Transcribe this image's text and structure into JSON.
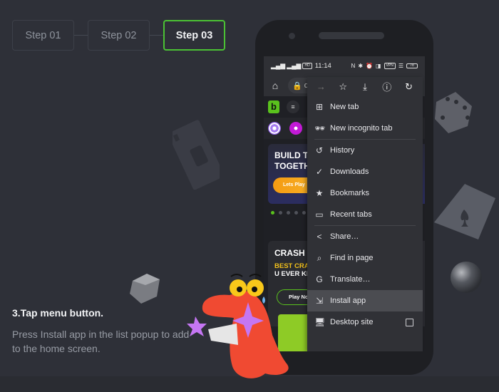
{
  "steps": [
    {
      "label": "Step 01",
      "active": false
    },
    {
      "label": "Step 02",
      "active": false
    },
    {
      "label": "Step 03",
      "active": true
    }
  ],
  "instruction": {
    "title": "3.Tap menu button.",
    "description": "Press Install app in the list popup to add to the home screen."
  },
  "phone": {
    "status_bar": {
      "left_icons": [
        "signal-icon",
        "signal-icon",
        "hd-icon"
      ],
      "time": "11:14",
      "right_icons": [
        "nfc-icon",
        "bluetooth-icon",
        "alarm-icon",
        "vibrate-icon",
        "vpn-icon",
        "wifi-icon",
        "battery-icon"
      ],
      "vpn_label": "VPN",
      "battery_label": "78"
    },
    "url_bar": {
      "home_icon": "home-icon",
      "lock_icon": "lock-icon",
      "url_text": "d"
    },
    "site": {
      "logo_text": "b",
      "banner1": {
        "title_line1": "BUILD T",
        "title_line2": "TOGETH",
        "button": "Lets Play"
      },
      "banner2": {
        "title": "CRASH",
        "sub_line1": "BEST CRAS",
        "sub_line2": "U EVER KN",
        "button": "Play Now"
      }
    },
    "menu": {
      "toolbar": [
        {
          "icon": "forward-icon",
          "glyph": "→",
          "enabled": false
        },
        {
          "icon": "star-icon",
          "glyph": "☆",
          "enabled": true
        },
        {
          "icon": "download-icon",
          "glyph": "⤓",
          "enabled": true
        },
        {
          "icon": "info-icon",
          "glyph": "ⓘ",
          "enabled": true
        },
        {
          "icon": "refresh-icon",
          "glyph": "↻",
          "enabled": true
        }
      ],
      "groups": [
        [
          {
            "label": "New tab",
            "icon": "new-tab-icon",
            "glyph": "⊞"
          },
          {
            "label": "New incognito tab",
            "icon": "incognito-icon",
            "glyph": "🕶"
          }
        ],
        [
          {
            "label": "History",
            "icon": "history-icon",
            "glyph": "↺"
          },
          {
            "label": "Downloads",
            "icon": "downloads-icon",
            "glyph": "✓"
          },
          {
            "label": "Bookmarks",
            "icon": "bookmarks-icon",
            "glyph": "★"
          },
          {
            "label": "Recent tabs",
            "icon": "recent-tabs-icon",
            "glyph": "▭"
          }
        ],
        [
          {
            "label": "Share…",
            "icon": "share-icon",
            "glyph": "<"
          },
          {
            "label": "Find in page",
            "icon": "find-in-page-icon",
            "glyph": "⌕"
          },
          {
            "label": "Translate…",
            "icon": "translate-icon",
            "glyph": "G"
          },
          {
            "label": "Install app",
            "icon": "install-app-icon",
            "glyph": "⇲",
            "highlighted": true
          },
          {
            "label": "Desktop site",
            "icon": "desktop-site-icon",
            "glyph": "🖥",
            "checkbox": true,
            "checked": false
          }
        ]
      ]
    }
  },
  "colors": {
    "background": "#2e3038",
    "accent_green": "#4bc234",
    "menu_bg": "#303136",
    "menu_highlight": "#4b4c51"
  }
}
